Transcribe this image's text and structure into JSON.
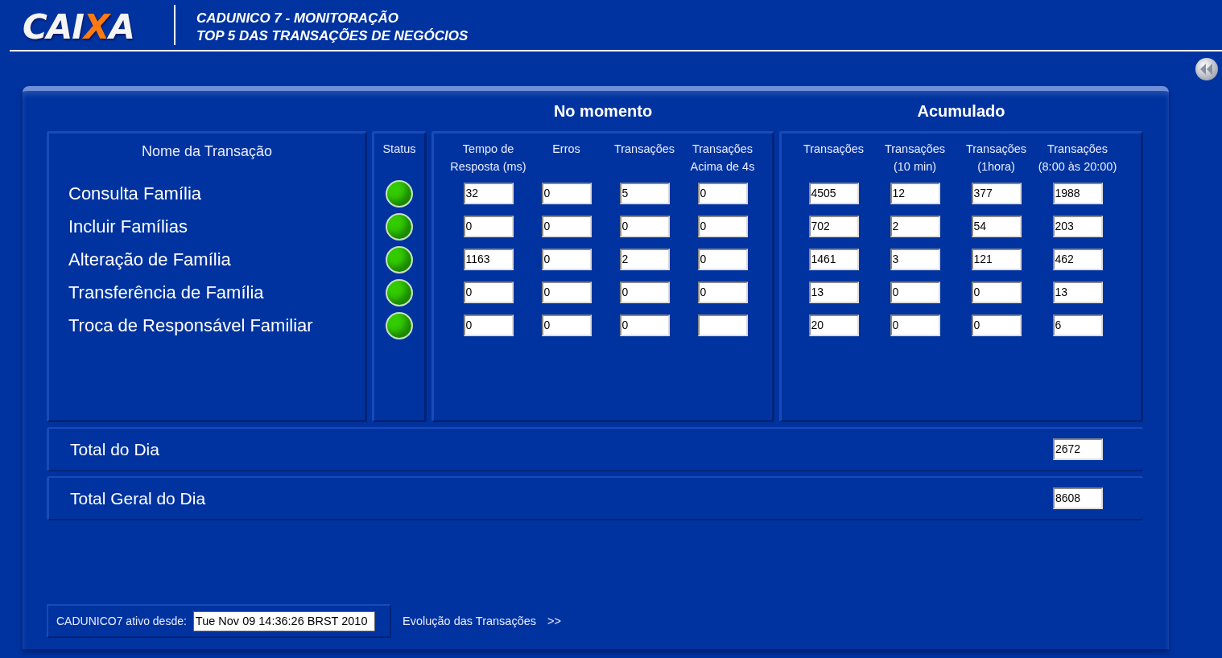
{
  "header": {
    "logo": "CAIXA",
    "title_lines": [
      "CADUNICO 7 - MONITORAÇÃO",
      "TOP 5 DAS TRANSAÇÕES DE NEGÓCIOS"
    ]
  },
  "groups": [
    {
      "title": "No momento"
    },
    {
      "title": "Acumulado"
    }
  ],
  "name_column": "Nome da Transação",
  "status_column": "Status",
  "momento_columns": [
    [
      "Tempo de",
      "Resposta (ms)"
    ],
    [
      "Erros"
    ],
    [
      "Transações"
    ],
    [
      "Transações",
      "Acima de 4s"
    ]
  ],
  "acumulado_columns": [
    [
      "Transações"
    ],
    [
      "Transações",
      "(10 min)"
    ],
    [
      "Transações",
      "(1hora)"
    ],
    [
      "Transações",
      "(8:00 às 20:00)"
    ]
  ],
  "rows": [
    {
      "name": "Consulta Família",
      "color": "#33cc00",
      "momento": [
        "32",
        "0",
        "5",
        "0"
      ],
      "acumulado": [
        "4505",
        "12",
        "377",
        "1988"
      ]
    },
    {
      "name": "Incluir Famílias",
      "color": "#33cc00",
      "momento": [
        "0",
        "0",
        "0",
        "0"
      ],
      "acumulado": [
        "702",
        "2",
        "54",
        "203"
      ]
    },
    {
      "name": "Alteração de Família",
      "color": "#33cc00",
      "momento": [
        "1163",
        "0",
        "2",
        "0"
      ],
      "acumulado": [
        "1461",
        "3",
        "121",
        "462"
      ]
    },
    {
      "name": "Transferência de Família",
      "color": "#33cc00",
      "momento": [
        "0",
        "0",
        "0",
        "0"
      ],
      "acumulado": [
        "13",
        "0",
        "0",
        "13"
      ]
    },
    {
      "name": "Troca de Responsável Familiar",
      "color": "#33cc00",
      "momento": [
        "0",
        "0",
        "0"
      ],
      "acumulado": [
        "20",
        "0",
        "0",
        "6"
      ]
    }
  ],
  "totals": [
    {
      "label": "Total do Dia",
      "value": "2672"
    },
    {
      "label": "Total Geral do Dia",
      "value": "8608"
    }
  ],
  "footer": {
    "label": "CADUNICO7 ativo desde:",
    "value": "Tue Nov 09 14:36:26 BRST 2010",
    "link": "Evolução das Transações",
    "link_arrow": ">>"
  }
}
